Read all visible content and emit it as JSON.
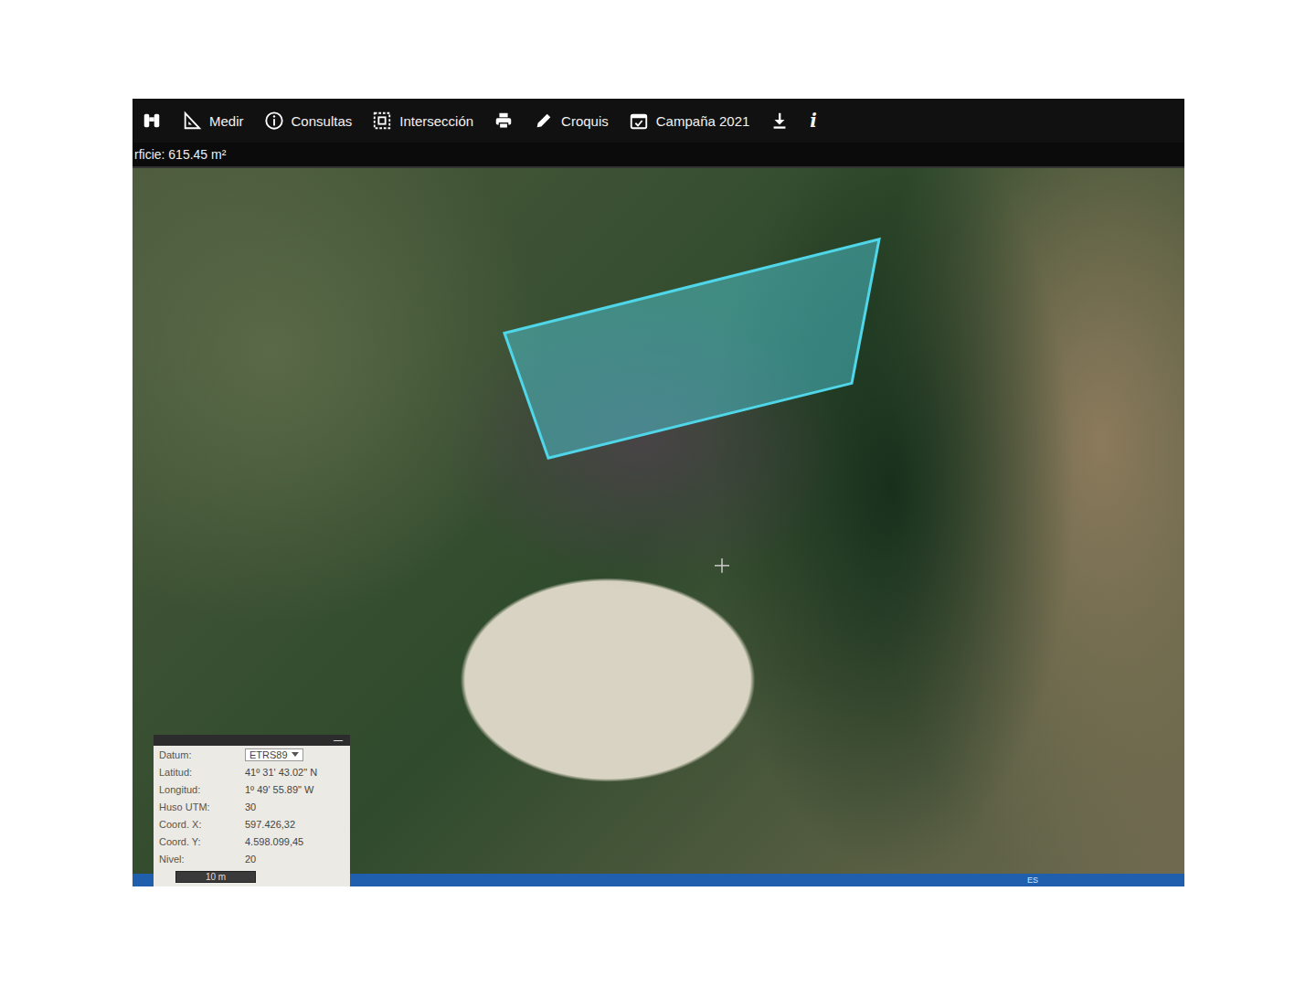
{
  "toolbar": {
    "items": [
      {
        "kind": "binoculars"
      },
      {
        "kind": "ruler",
        "label": "Medir"
      },
      {
        "kind": "info",
        "label": "Consultas"
      },
      {
        "kind": "intersection",
        "label": "Intersección"
      },
      {
        "kind": "print"
      },
      {
        "kind": "pencil",
        "label": "Croquis"
      },
      {
        "kind": "calendar",
        "label": "Campaña 2021"
      },
      {
        "kind": "download"
      },
      {
        "kind": "glyph",
        "label": "i"
      }
    ]
  },
  "measure": {
    "text": "rficie: 615.45 m²"
  },
  "parcel": {
    "color": "#4fd6e8"
  },
  "coords_panel": {
    "minimize": "—",
    "rows": [
      {
        "label": "Datum:",
        "value": "ETRS89",
        "kind": "select"
      },
      {
        "label": "Latitud:",
        "value": "41º 31' 43.02\" N",
        "kind": "text"
      },
      {
        "label": "Longitud:",
        "value": "1º 49' 55.89\" W",
        "kind": "text"
      },
      {
        "label": "Huso UTM:",
        "value": "30",
        "kind": "text"
      },
      {
        "label": "Coord. X:",
        "value": "597.426,32",
        "kind": "text"
      },
      {
        "label": "Coord. Y:",
        "value": "4.598.099,45",
        "kind": "text"
      },
      {
        "label": "Nivel:",
        "value": "20",
        "kind": "text"
      }
    ],
    "scale": "10 m"
  },
  "taskbar": {
    "language": "ES"
  }
}
